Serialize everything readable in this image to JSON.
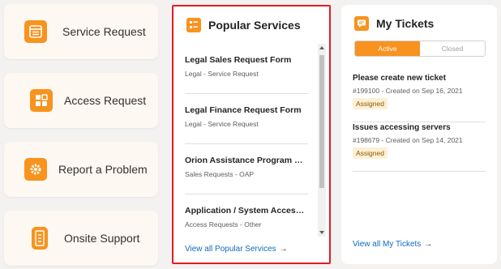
{
  "quick_actions": [
    {
      "label": "Service Request",
      "icon": "form-icon"
    },
    {
      "label": "Access Request",
      "icon": "grid-icon"
    },
    {
      "label": "Report a Problem",
      "icon": "gear-icon"
    },
    {
      "label": "Onsite Support",
      "icon": "building-icon"
    }
  ],
  "popular_services": {
    "title": "Popular Services",
    "items": [
      {
        "title": "Legal Sales Request Form",
        "subtitle": "Legal - Service Request"
      },
      {
        "title": "Legal Finance Request Form",
        "subtitle": "Legal - Service Request"
      },
      {
        "title": "Orion Assistance Program Nominations",
        "subtitle": "Sales Requests - OAP"
      },
      {
        "title": "Application / System Access Request",
        "subtitle": "Access Requests - Other"
      }
    ],
    "view_all": "View all Popular Services"
  },
  "my_tickets": {
    "title": "My Tickets",
    "tabs": {
      "active": "Active",
      "closed": "Closed"
    },
    "items": [
      {
        "title": "Please create new ticket",
        "meta": "#199100 - Created on Sep 16, 2021",
        "status": "Assigned"
      },
      {
        "title": "Issues accessing servers",
        "meta": "#198679 - Created on Sep 14, 2021",
        "status": "Assigned"
      }
    ],
    "view_all": "View all My Tickets"
  },
  "colors": {
    "accent": "#f7931e",
    "highlight_border": "#e01c24",
    "link": "#0f6cbd",
    "badge_bg": "#fdf0d5"
  }
}
